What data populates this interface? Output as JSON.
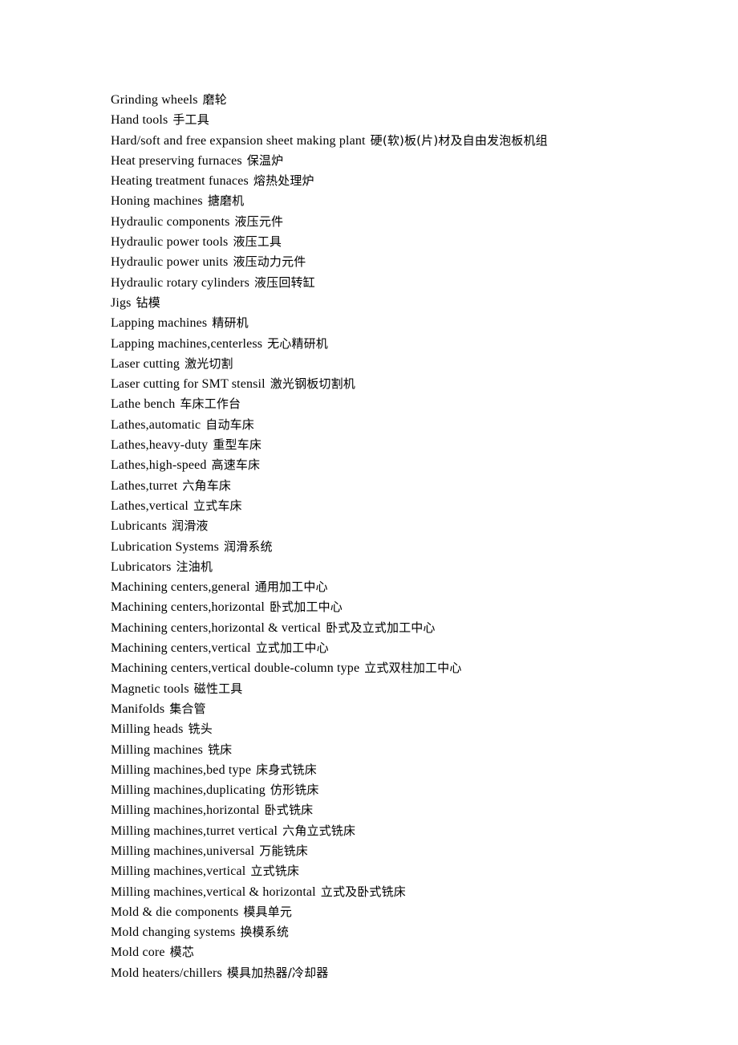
{
  "document": {
    "page_background": "#ffffff",
    "text_color": "#000000",
    "entries": [
      {
        "en": "Grinding wheels",
        "zh": "磨轮"
      },
      {
        "en": "Hand tools",
        "zh": "手工具"
      },
      {
        "en": "Hard/soft and free expansion sheet making plant",
        "zh": "硬(软)板(片)材及自由发泡板机组"
      },
      {
        "en": "Heat preserving furnaces",
        "zh": "保温炉"
      },
      {
        "en": "Heating treatment funaces",
        "zh": "熔热处理炉"
      },
      {
        "en": "Honing machines",
        "zh": "搪磨机"
      },
      {
        "en": "Hydraulic components",
        "zh": "液压元件"
      },
      {
        "en": "Hydraulic power tools",
        "zh": "液压工具"
      },
      {
        "en": "Hydraulic power units",
        "zh": "液压动力元件"
      },
      {
        "en": "Hydraulic rotary cylinders",
        "zh": "液压回转缸"
      },
      {
        "en": "Jigs",
        "zh": "钻模"
      },
      {
        "en": "Lapping machines",
        "zh": "精研机"
      },
      {
        "en": "Lapping machines,centerless",
        "zh": "无心精研机"
      },
      {
        "en": "Laser cutting",
        "zh": "激光切割"
      },
      {
        "en": "Laser cutting for SMT stensil",
        "zh": "激光钢板切割机"
      },
      {
        "en": "Lathe bench",
        "zh": "车床工作台"
      },
      {
        "en": "Lathes,automatic",
        "zh": "自动车床"
      },
      {
        "en": "Lathes,heavy-duty",
        "zh": "重型车床"
      },
      {
        "en": "Lathes,high-speed",
        "zh": "高速车床"
      },
      {
        "en": "Lathes,turret",
        "zh": "六角车床"
      },
      {
        "en": "Lathes,vertical",
        "zh": "立式车床"
      },
      {
        "en": "Lubricants",
        "zh": "润滑液"
      },
      {
        "en": "Lubrication Systems",
        "zh": "润滑系统"
      },
      {
        "en": "Lubricators",
        "zh": "注油机"
      },
      {
        "en": "Machining centers,general",
        "zh": "通用加工中心"
      },
      {
        "en": "Machining centers,horizontal",
        "zh": "卧式加工中心"
      },
      {
        "en": "Machining centers,horizontal & vertical",
        "zh": "卧式及立式加工中心"
      },
      {
        "en": "Machining centers,vertical",
        "zh": "立式加工中心"
      },
      {
        "en": "Machining centers,vertical double-column type",
        "zh": "立式双柱加工中心"
      },
      {
        "en": "Magnetic tools",
        "zh": "磁性工具"
      },
      {
        "en": "Manifolds",
        "zh": "集合管"
      },
      {
        "en": "Milling heads",
        "zh": "铣头"
      },
      {
        "en": "Milling machines",
        "zh": "铣床"
      },
      {
        "en": "Milling machines,bed type",
        "zh": "床身式铣床"
      },
      {
        "en": "Milling machines,duplicating",
        "zh": "仿形铣床"
      },
      {
        "en": "Milling machines,horizontal",
        "zh": "卧式铣床"
      },
      {
        "en": "Milling machines,turret vertical",
        "zh": "六角立式铣床"
      },
      {
        "en": "Milling machines,universal",
        "zh": "万能铣床"
      },
      {
        "en": "Milling machines,vertical",
        "zh": "立式铣床"
      },
      {
        "en": "Milling machines,vertical & horizontal",
        "zh": "立式及卧式铣床"
      },
      {
        "en": "Mold & die components",
        "zh": "模具单元"
      },
      {
        "en": "Mold changing systems",
        "zh": "换模系统"
      },
      {
        "en": "Mold core",
        "zh": "模芯"
      },
      {
        "en": "Mold heaters/chillers",
        "zh": "模具加热器/冷却器"
      }
    ]
  }
}
